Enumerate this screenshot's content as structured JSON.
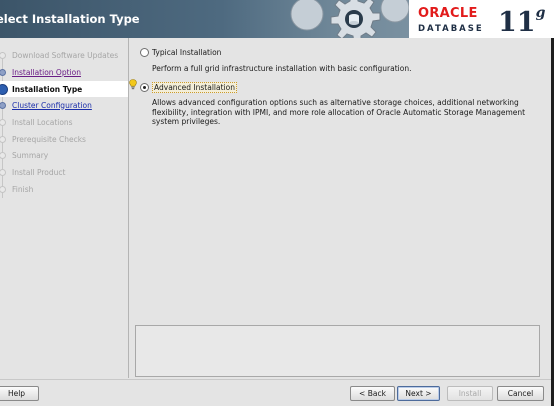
{
  "header": {
    "title": "elect Installation Type",
    "brand": {
      "oracle": "ORACLE",
      "database": "DATABASE",
      "version": "11",
      "version_sup": "g"
    }
  },
  "nav": {
    "items": [
      {
        "label": "Download Software Updates",
        "state": "disabled"
      },
      {
        "label": "Installation Option",
        "state": "visited"
      },
      {
        "label": "Installation Type",
        "state": "current"
      },
      {
        "label": "Cluster Configuration",
        "state": "link"
      },
      {
        "label": "Install Locations",
        "state": "disabled"
      },
      {
        "label": "Prerequisite Checks",
        "state": "disabled"
      },
      {
        "label": "Summary",
        "state": "disabled"
      },
      {
        "label": "Install Product",
        "state": "disabled"
      },
      {
        "label": "Finish",
        "state": "disabled"
      }
    ]
  },
  "options": {
    "typical": {
      "label": "Typical Installation",
      "selected": false,
      "description": "Perform a full grid infrastructure installation with basic configuration."
    },
    "advanced": {
      "label": "Advanced Installation",
      "selected": true,
      "description": "Allows advanced configuration options such as alternative storage choices, additional networking flexibility, integration with IPMI, and more role allocation of Oracle Automatic Storage Management system privileges."
    }
  },
  "footer": {
    "help": "Help",
    "back": "< Back",
    "next": "Next >",
    "install": "Install",
    "cancel": "Cancel"
  },
  "colors": {
    "header_gradient_start": "#3c5569",
    "oracle_red": "#e21b1b",
    "link_blue": "#1b2eaa",
    "visited_purple": "#6a1d86"
  }
}
